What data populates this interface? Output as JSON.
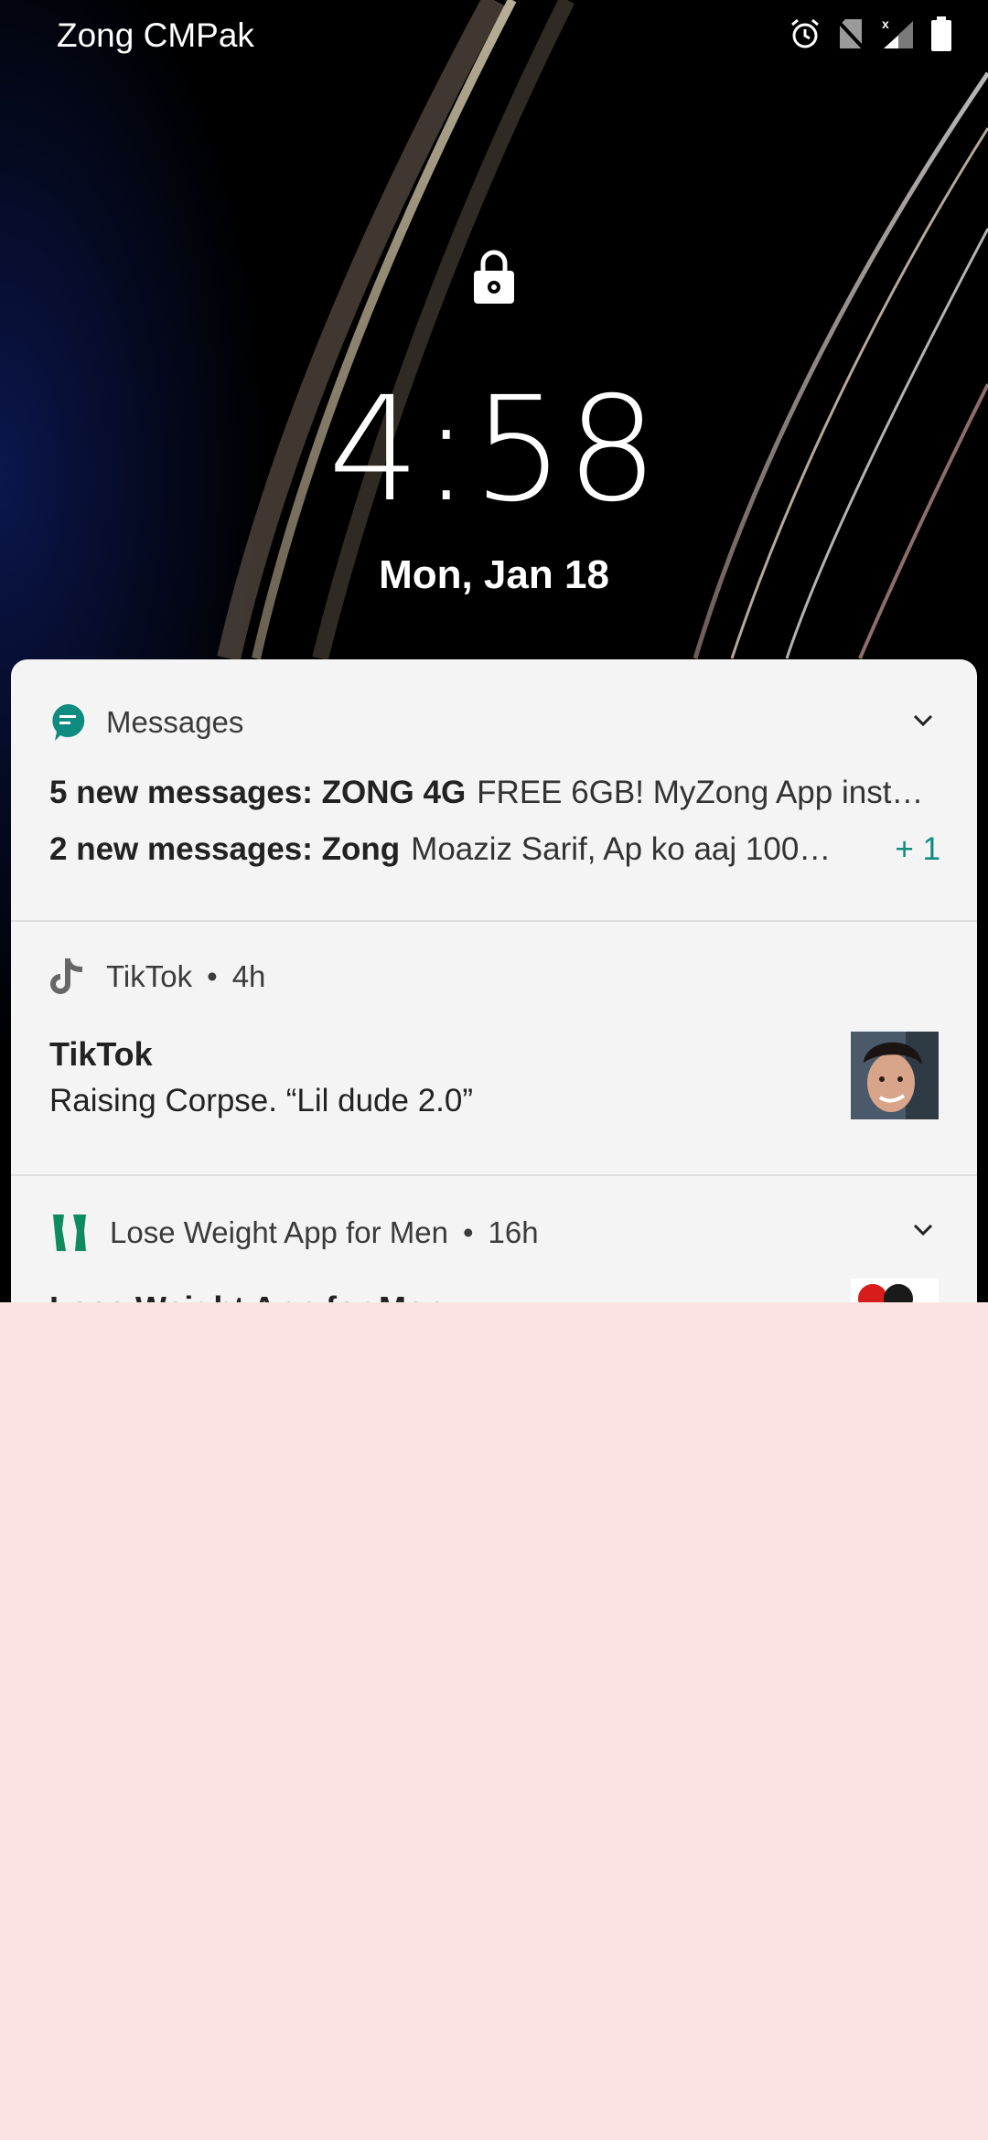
{
  "statusbar": {
    "carrier": "Zong CMPak",
    "icons": [
      "alarm-icon",
      "no-sim-icon",
      "signal-icon",
      "battery-icon"
    ]
  },
  "lock": {
    "time": "4:58",
    "date": "Mon, Jan 18"
  },
  "notifications": {
    "messages": {
      "app": "Messages",
      "lines": [
        {
          "sender": "5 new messages: ZONG 4G",
          "preview": "FREE 6GB! MyZong App inst…"
        },
        {
          "sender": "2 new messages: Zong",
          "preview": "Moaziz Sarif, Ap ko aaj 100…"
        }
      ],
      "more": "+ 1"
    },
    "tiktok": {
      "app": "TikTok",
      "age": "4h",
      "title": "TikTok",
      "text": "Raising Corpse. “Lil dude 2.0”"
    },
    "loseweight": {
      "app": "Lose Weight App for Men",
      "age": "16h",
      "title": "Lose Weight App for Men"
    }
  },
  "colors": {
    "accent": "#0f8b80",
    "card": "#f4f4f4",
    "below_overlay": "#fbe3e3"
  }
}
